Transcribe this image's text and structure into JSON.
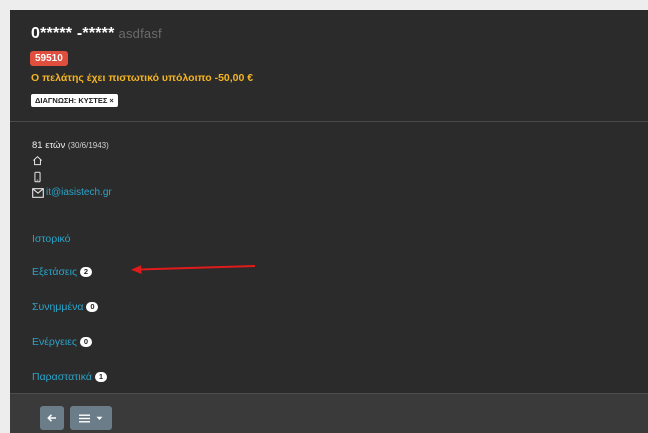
{
  "patient": {
    "name": "0***** -*****",
    "subtitle": "asdfasf",
    "code": "59510",
    "credit_message": "Ο πελάτης έχει πιστωτικό υπόλοιπο -50,00 €",
    "diagnosis_tag": "ΔΙΑΓΝΩΣΗ: ΚΥΣΤΕΣ ×",
    "age": "81 ετών",
    "dob": "(30/6/1943)",
    "email": "it@iasistech.gr"
  },
  "nav": [
    {
      "label": "Ιστορικό",
      "count": null
    },
    {
      "label": "Εξετάσεις",
      "count": "2"
    },
    {
      "label": "Συνημμένα",
      "count": "0"
    },
    {
      "label": "Ενέργειες",
      "count": "0"
    },
    {
      "label": "Παραστατικά",
      "count": "1"
    }
  ],
  "colors": {
    "accent": "#2aa4c9",
    "warning": "#f5b522",
    "badge": "#e04e3e",
    "annotation_arrow": "#e01b1b"
  },
  "icons": [
    "home-icon",
    "mobile-icon",
    "mail-icon",
    "back-arrow-icon",
    "menu-icon",
    "caret-down-icon"
  ]
}
